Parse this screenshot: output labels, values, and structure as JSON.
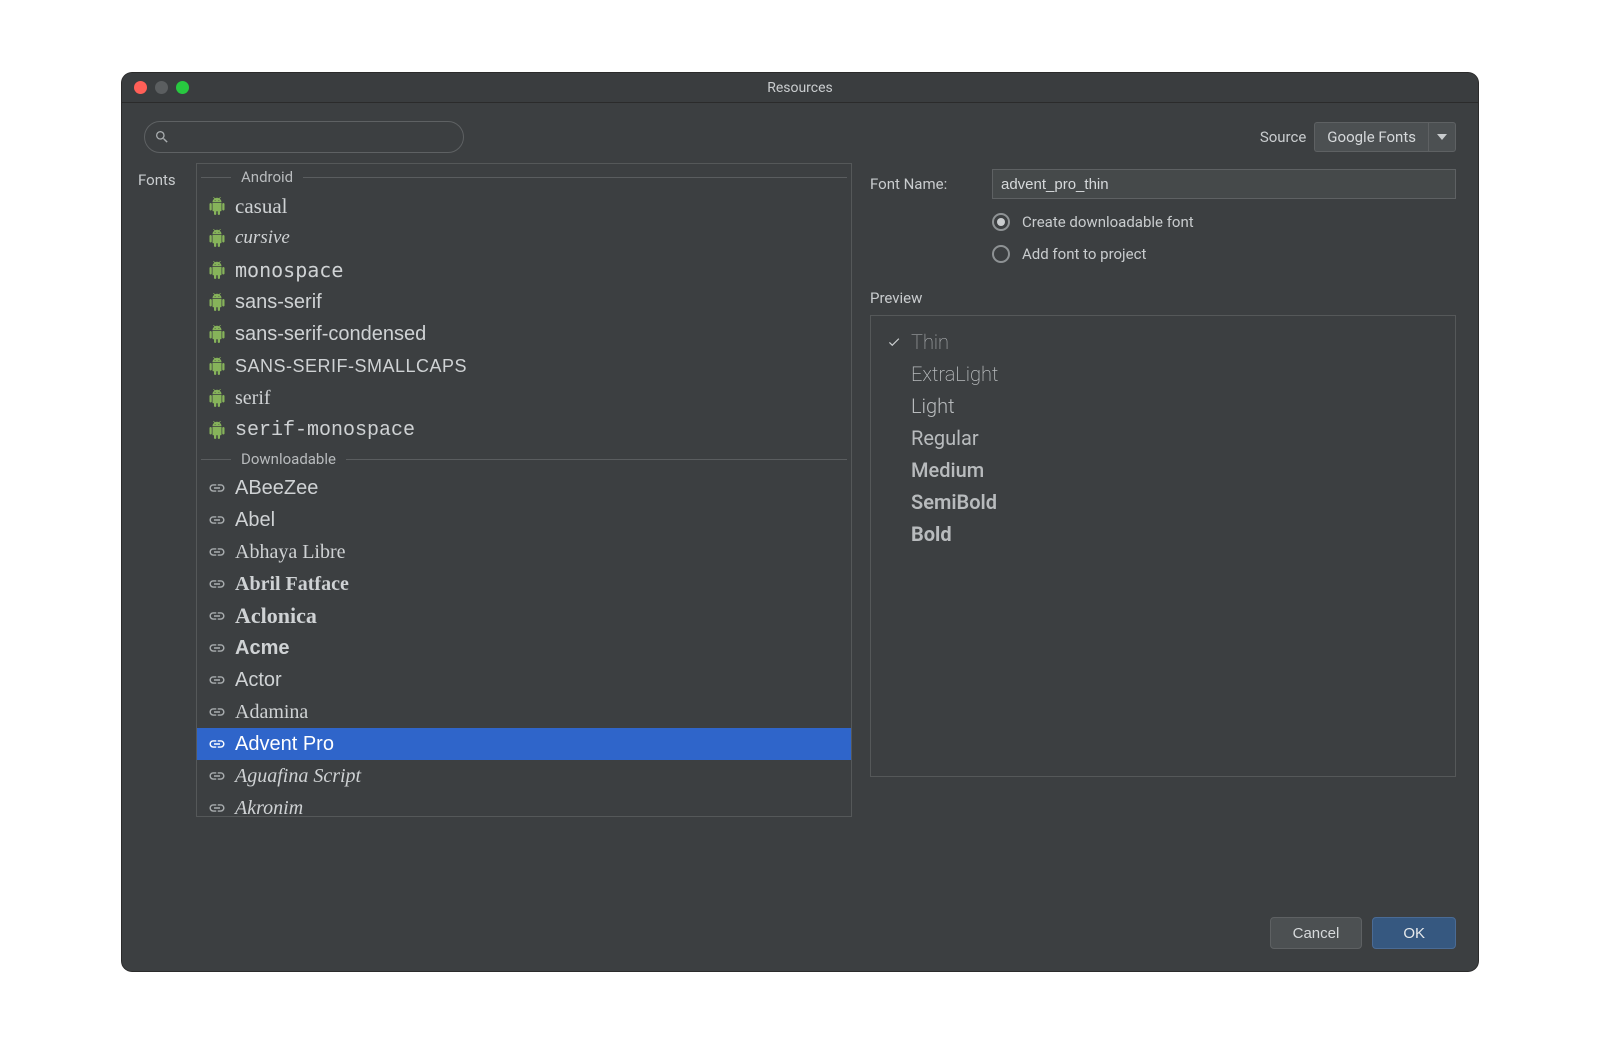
{
  "window": {
    "title": "Resources"
  },
  "search": {
    "placeholder": ""
  },
  "source": {
    "label": "Source",
    "selected": "Google Fonts"
  },
  "fonts_label": "Fonts",
  "groups": {
    "android": {
      "header": "Android",
      "items": [
        {
          "name": "casual",
          "style": "ff-casual"
        },
        {
          "name": "cursive",
          "style": "ff-cursive"
        },
        {
          "name": "monospace",
          "style": "ff-mono"
        },
        {
          "name": "sans-serif",
          "style": "ff-sans"
        },
        {
          "name": "sans-serif-condensed",
          "style": "ff-sanscond"
        },
        {
          "name": "SANS-SERIF-SMALLCAPS",
          "style": "ff-smallcaps"
        },
        {
          "name": "serif",
          "style": "ff-serif"
        },
        {
          "name": "serif-monospace",
          "style": "ff-serifmono"
        }
      ]
    },
    "downloadable": {
      "header": "Downloadable",
      "items": [
        {
          "name": "ABeeZee",
          "style": "ff-sans"
        },
        {
          "name": "Abel",
          "style": "ff-sanscond"
        },
        {
          "name": "Abhaya Libre",
          "style": "ff-libre"
        },
        {
          "name": "Abril Fatface",
          "style": "ff-abril"
        },
        {
          "name": "Aclonica",
          "style": "ff-aclonica"
        },
        {
          "name": "Acme",
          "style": "ff-acme"
        },
        {
          "name": "Actor",
          "style": "ff-sans"
        },
        {
          "name": "Adamina",
          "style": "ff-adamina"
        },
        {
          "name": "Advent Pro",
          "style": "ff-advent",
          "selected": true
        },
        {
          "name": "Aguafina Script",
          "style": "ff-aguafina"
        },
        {
          "name": "Akronim",
          "style": "ff-akronim"
        }
      ]
    }
  },
  "form": {
    "font_name_label": "Font Name:",
    "font_name_value": "advent_pro_thin",
    "radio_downloadable": "Create downloadable font",
    "radio_add_project": "Add font to project",
    "radio_selected": "downloadable"
  },
  "preview": {
    "label": "Preview",
    "items": [
      {
        "name": "Thin",
        "weight": "w100",
        "checked": true
      },
      {
        "name": "ExtraLight",
        "weight": "w200"
      },
      {
        "name": "Light",
        "weight": "w300"
      },
      {
        "name": "Regular",
        "weight": "w400"
      },
      {
        "name": "Medium",
        "weight": "w500"
      },
      {
        "name": "SemiBold",
        "weight": "w600"
      },
      {
        "name": "Bold",
        "weight": "w700"
      }
    ]
  },
  "footer": {
    "cancel": "Cancel",
    "ok": "OK"
  }
}
